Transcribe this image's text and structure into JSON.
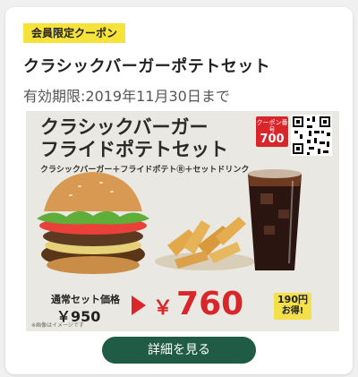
{
  "coupon": {
    "badge": "会員限定クーポン",
    "title": "クラシックバーガーポテトセット",
    "expiry": "有効期限:2019年11月30日まで"
  },
  "promo": {
    "title_line1": "クラシックバーガー",
    "title_line2": "フライドポテトセット",
    "subtitle": "クラシックバーガー＋フライドポテトⓇ＋セットドリンク",
    "coupon_label": "クーポン番号",
    "coupon_number": "700",
    "regular_label": "通常セット価格",
    "regular_price": "￥950",
    "sale_currency": "￥",
    "sale_price": "760",
    "savings_amount": "190円",
    "savings_label": "お得!",
    "fine_print": "※画像はイメージです"
  },
  "actions": {
    "detail_button": "詳細を見る"
  },
  "colors": {
    "badge_bg": "#f5e23a",
    "sale_red": "#d8262b",
    "button_green": "#1f5b45"
  }
}
